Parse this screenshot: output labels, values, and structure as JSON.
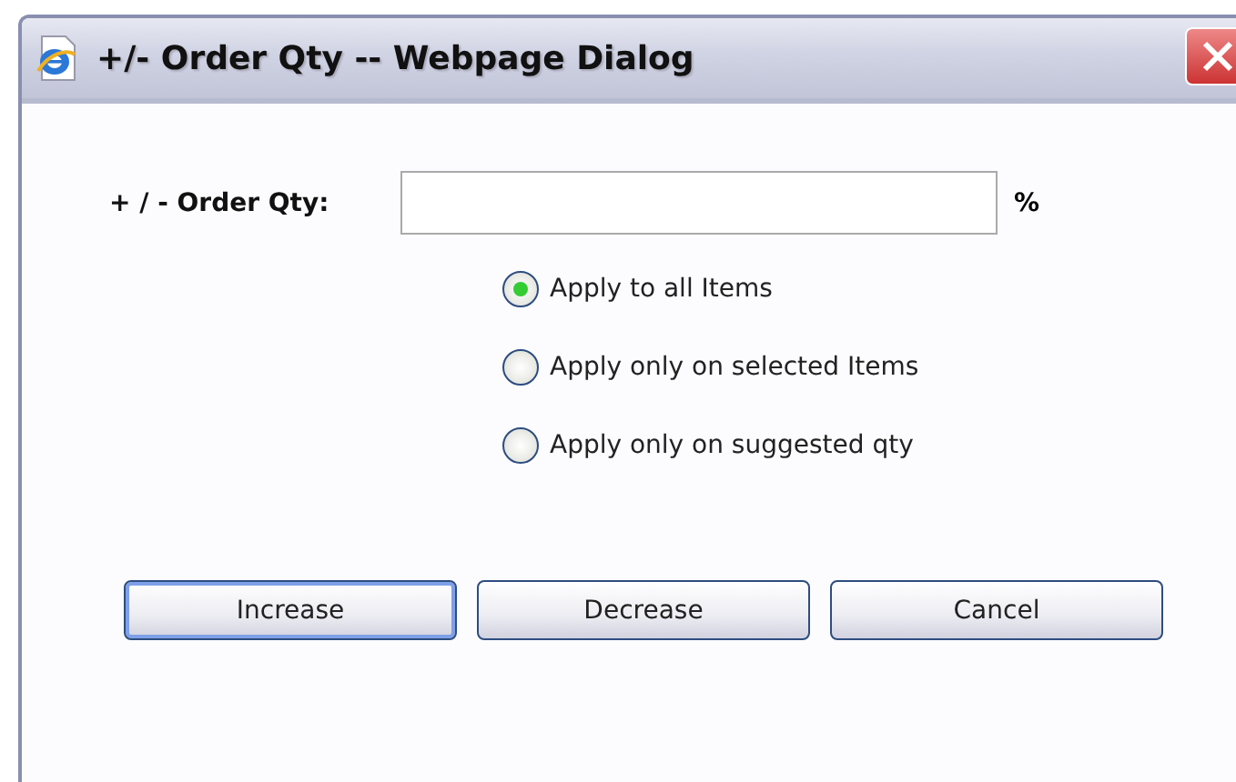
{
  "window": {
    "title": "+/- Order Qty -- Webpage Dialog"
  },
  "field": {
    "label": "+ / - Order Qty:",
    "unit": "%"
  },
  "options": [
    {
      "label": "Apply to all Items",
      "selected": true
    },
    {
      "label": "Apply only on selected Items",
      "selected": false
    },
    {
      "label": "Apply only on suggested qty",
      "selected": false
    }
  ],
  "buttons": [
    {
      "label": "Increase",
      "focused": true
    },
    {
      "label": "Decrease",
      "focused": false
    },
    {
      "label": "Cancel",
      "focused": false
    }
  ]
}
